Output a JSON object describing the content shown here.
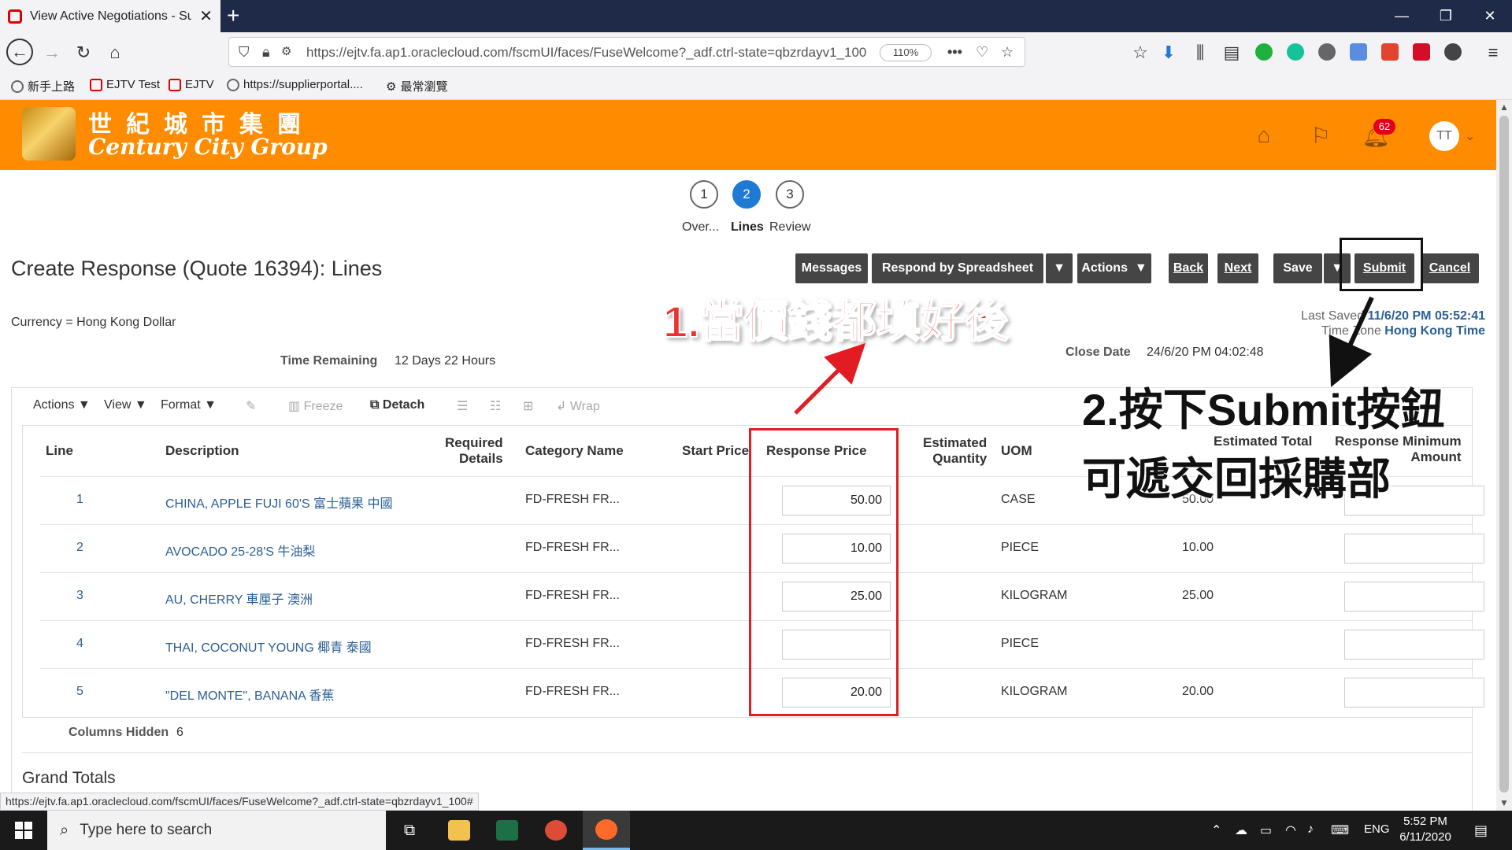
{
  "browser": {
    "tab_title": "View Active Negotiations - Sup",
    "url": "https://ejtv.fa.ap1.oraclecloud.com/fscmUI/faces/FuseWelcome?_adf.ctrl-state=qbzrdayv1_100",
    "zoom": "110%",
    "bookmarks": [
      "新手上路",
      "EJTV Test",
      "EJTV",
      "https://supplierportal....",
      "最常瀏覽"
    ],
    "status_url": "https://ejtv.fa.ap1.oraclecloud.com/fscmUI/faces/FuseWelcome?_adf.ctrl-state=qbzrdayv1_100#"
  },
  "header": {
    "logo_zh": "世紀城市集團",
    "logo_en": "Century City Group",
    "notification_count": "62",
    "avatar_initials": "TT",
    "brand_color": "#ff8c00"
  },
  "train": {
    "steps": [
      {
        "num": "1",
        "label": "Over..."
      },
      {
        "num": "2",
        "label": "Lines"
      },
      {
        "num": "3",
        "label": "Review"
      }
    ],
    "active_step": 2
  },
  "page": {
    "title": "Create Response (Quote 16394): Lines",
    "currency": "Currency = Hong Kong Dollar",
    "time_remaining_label": "Time Remaining",
    "time_remaining_value": "12 Days 22 Hours",
    "close_date_label": "Close Date",
    "close_date_value": "24/6/20 PM 04:02:48",
    "last_saved_label": "Last Saved",
    "last_saved_value": "11/6/20 PM 05:52:41",
    "time_zone_label": "Time Zone",
    "time_zone_value": "Hong Kong Time"
  },
  "buttons": {
    "messages": "Messages",
    "respond_by_spreadsheet": "Respond by Spreadsheet",
    "actions": "Actions",
    "back": "Back",
    "next": "Next",
    "save": "Save",
    "submit": "Submit",
    "cancel": "Cancel"
  },
  "table_toolbar": {
    "actions": "Actions",
    "view": "View",
    "format": "Format",
    "freeze": "Freeze",
    "detach": "Detach",
    "wrap": "Wrap"
  },
  "table": {
    "headers": {
      "line": "Line",
      "description": "Description",
      "required_details": [
        "Required",
        "Details"
      ],
      "category_name": "Category Name",
      "start_price": "Start Price",
      "response_price": "Response Price",
      "estimated_quantity": [
        "Estimated",
        "Quantity"
      ],
      "uom": "UOM",
      "estimated_total": [
        "Estimated Total",
        ""
      ],
      "response_minimum": [
        "Response Minimum",
        "Amount"
      ]
    },
    "rows": [
      {
        "line": "1",
        "description": "CHINA, APPLE FUJI 60'S 富士蘋果 中國",
        "category": "FD-FRESH FR...",
        "response_price": "50.00",
        "uom": "CASE",
        "estimated_total": "50.00"
      },
      {
        "line": "2",
        "description": "AVOCADO 25-28'S 牛油梨",
        "category": "FD-FRESH FR...",
        "response_price": "10.00",
        "uom": "PIECE",
        "estimated_total": "10.00"
      },
      {
        "line": "3",
        "description": "AU, CHERRY 車厘子 澳洲",
        "category": "FD-FRESH FR...",
        "response_price": "25.00",
        "uom": "KILOGRAM",
        "estimated_total": "25.00"
      },
      {
        "line": "4",
        "description": "THAI, COCONUT YOUNG 椰青 泰國",
        "category": "FD-FRESH FR...",
        "response_price": "",
        "uom": "PIECE",
        "estimated_total": ""
      },
      {
        "line": "5",
        "description": "\"DEL MONTE\", BANANA 香蕉",
        "category": "FD-FRESH FR...",
        "response_price": "20.00",
        "uom": "KILOGRAM",
        "estimated_total": "20.00"
      }
    ],
    "columns_hidden_label": "Columns Hidden",
    "columns_hidden_value": "6",
    "grand_totals": "Grand Totals"
  },
  "annotations": {
    "step1": "1.當價錢都填好後",
    "step2_line1": "2.按下Submit按鈕",
    "step2_line2": "可遞交回採購部"
  },
  "taskbar": {
    "search_placeholder": "Type here to search",
    "lang": "ENG",
    "time": "5:52 PM",
    "date": "6/11/2020"
  }
}
